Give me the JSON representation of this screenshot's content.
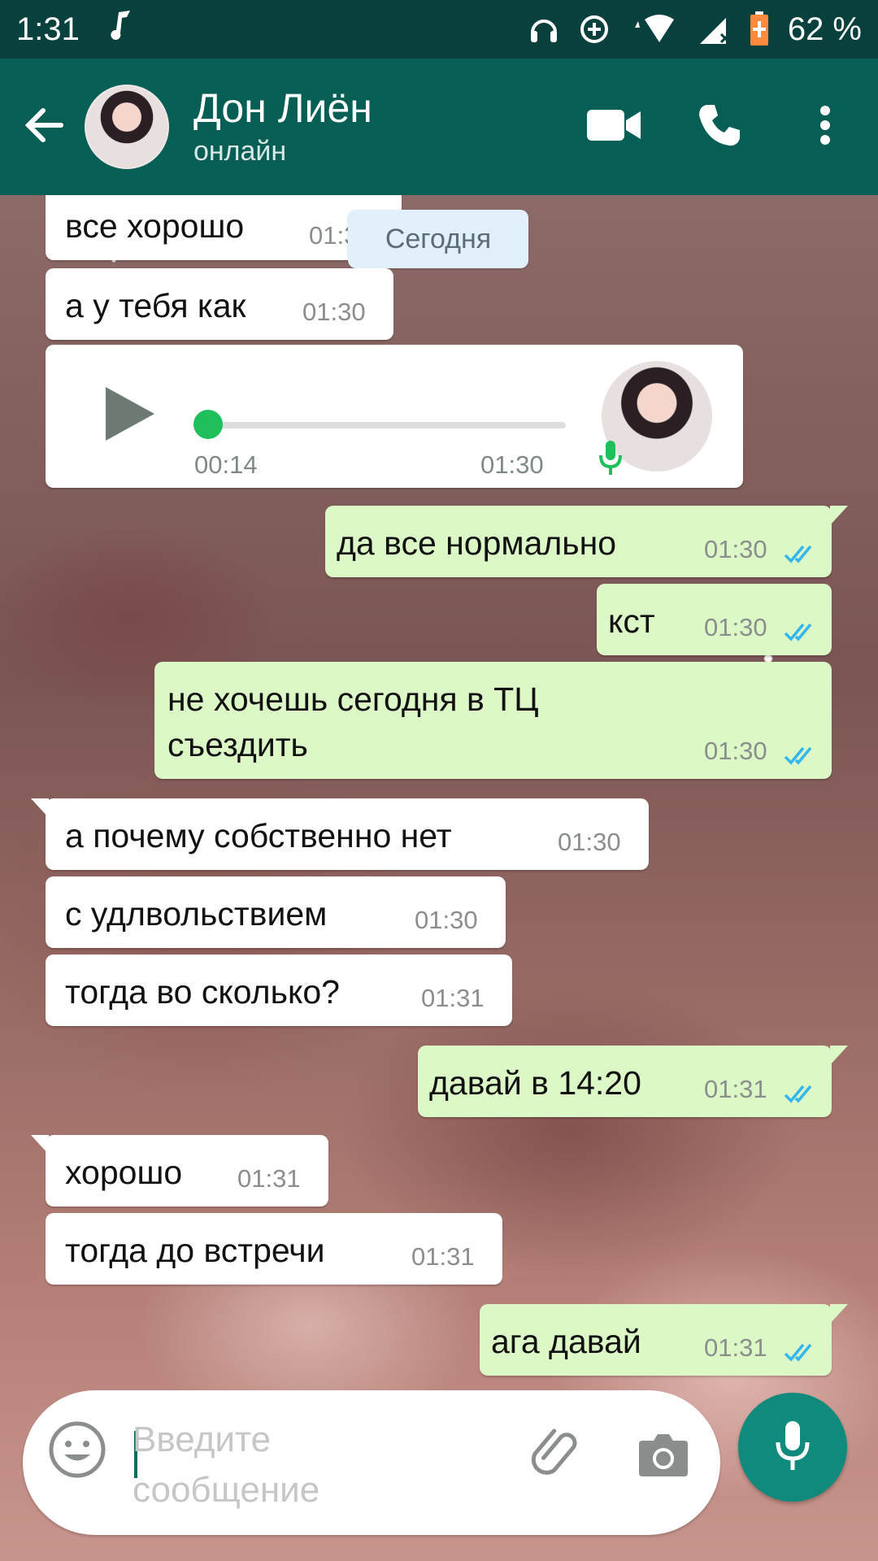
{
  "status_bar": {
    "time": "1:31",
    "battery": "62 %"
  },
  "header": {
    "contact_name": "Дон Лиён",
    "contact_status": "онлайн"
  },
  "chat": {
    "date_chip": "Сегодня",
    "messages": [
      {
        "direction": "in",
        "text": "все хорошо",
        "time": "01:30"
      },
      {
        "direction": "in",
        "text": "а у тебя как",
        "time": "01:30"
      },
      {
        "direction": "in",
        "type": "voice",
        "duration": "00:14",
        "time": "01:30",
        "progress": 0
      },
      {
        "direction": "out",
        "text": "да все нормально",
        "time": "01:30",
        "read": true
      },
      {
        "direction": "out",
        "text": "кст",
        "time": "01:30",
        "read": true
      },
      {
        "direction": "out",
        "text_line1": "не хочешь сегодня в ТЦ",
        "text_line2": "съездить",
        "time": "01:30",
        "read": true
      },
      {
        "direction": "in",
        "text": "а почему собственно нет",
        "time": "01:30"
      },
      {
        "direction": "in",
        "text": "с удлвольствием",
        "time": "01:30"
      },
      {
        "direction": "in",
        "text": "тогда во сколько?",
        "time": "01:31"
      },
      {
        "direction": "out",
        "text": "давай в 14:20",
        "time": "01:31",
        "read": true
      },
      {
        "direction": "in",
        "text": "хорошо",
        "time": "01:31"
      },
      {
        "direction": "in",
        "text": "тогда до встречи",
        "time": "01:31"
      },
      {
        "direction": "out",
        "text": "ага давай",
        "time": "01:31",
        "read": true
      }
    ]
  },
  "composer": {
    "placeholder": "Введите сообщение",
    "value": ""
  },
  "colors": {
    "header": "#075e54",
    "status_bar": "#07403d",
    "incoming_bubble": "#ffffff",
    "outgoing_bubble": "#dcf8c6",
    "read_ticks": "#34b7f1",
    "fab": "#0f8a7c"
  },
  "icons": {
    "back": "arrow-left-icon",
    "video": "video-camera-icon",
    "call": "phone-icon",
    "menu": "more-vert-icon",
    "emoji": "emoji-icon",
    "attach": "paperclip-icon",
    "camera": "camera-icon",
    "mic": "microphone-icon"
  }
}
